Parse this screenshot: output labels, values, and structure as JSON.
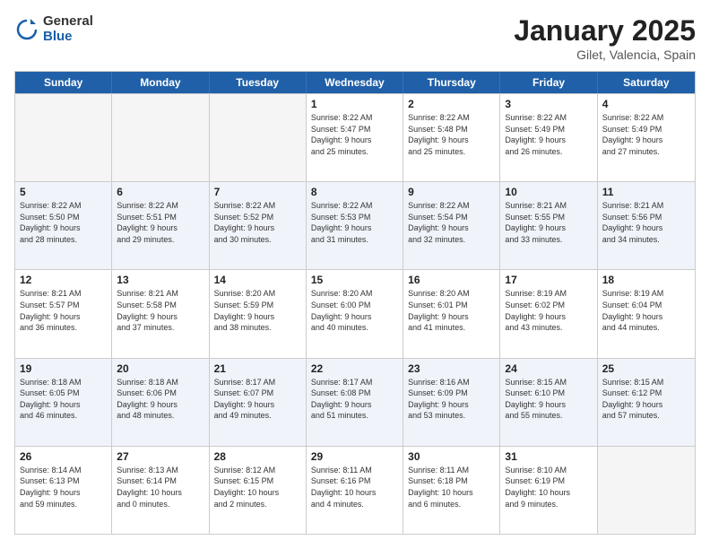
{
  "logo": {
    "general": "General",
    "blue": "Blue"
  },
  "title": "January 2025",
  "subtitle": "Gilet, Valencia, Spain",
  "days": [
    "Sunday",
    "Monday",
    "Tuesday",
    "Wednesday",
    "Thursday",
    "Friday",
    "Saturday"
  ],
  "weeks": [
    [
      {
        "day": "",
        "empty": true
      },
      {
        "day": "",
        "empty": true
      },
      {
        "day": "",
        "empty": true
      },
      {
        "day": "1",
        "line1": "Sunrise: 8:22 AM",
        "line2": "Sunset: 5:47 PM",
        "line3": "Daylight: 9 hours",
        "line4": "and 25 minutes."
      },
      {
        "day": "2",
        "line1": "Sunrise: 8:22 AM",
        "line2": "Sunset: 5:48 PM",
        "line3": "Daylight: 9 hours",
        "line4": "and 25 minutes."
      },
      {
        "day": "3",
        "line1": "Sunrise: 8:22 AM",
        "line2": "Sunset: 5:49 PM",
        "line3": "Daylight: 9 hours",
        "line4": "and 26 minutes."
      },
      {
        "day": "4",
        "line1": "Sunrise: 8:22 AM",
        "line2": "Sunset: 5:49 PM",
        "line3": "Daylight: 9 hours",
        "line4": "and 27 minutes."
      }
    ],
    [
      {
        "day": "5",
        "line1": "Sunrise: 8:22 AM",
        "line2": "Sunset: 5:50 PM",
        "line3": "Daylight: 9 hours",
        "line4": "and 28 minutes."
      },
      {
        "day": "6",
        "line1": "Sunrise: 8:22 AM",
        "line2": "Sunset: 5:51 PM",
        "line3": "Daylight: 9 hours",
        "line4": "and 29 minutes."
      },
      {
        "day": "7",
        "line1": "Sunrise: 8:22 AM",
        "line2": "Sunset: 5:52 PM",
        "line3": "Daylight: 9 hours",
        "line4": "and 30 minutes."
      },
      {
        "day": "8",
        "line1": "Sunrise: 8:22 AM",
        "line2": "Sunset: 5:53 PM",
        "line3": "Daylight: 9 hours",
        "line4": "and 31 minutes."
      },
      {
        "day": "9",
        "line1": "Sunrise: 8:22 AM",
        "line2": "Sunset: 5:54 PM",
        "line3": "Daylight: 9 hours",
        "line4": "and 32 minutes."
      },
      {
        "day": "10",
        "line1": "Sunrise: 8:21 AM",
        "line2": "Sunset: 5:55 PM",
        "line3": "Daylight: 9 hours",
        "line4": "and 33 minutes."
      },
      {
        "day": "11",
        "line1": "Sunrise: 8:21 AM",
        "line2": "Sunset: 5:56 PM",
        "line3": "Daylight: 9 hours",
        "line4": "and 34 minutes."
      }
    ],
    [
      {
        "day": "12",
        "line1": "Sunrise: 8:21 AM",
        "line2": "Sunset: 5:57 PM",
        "line3": "Daylight: 9 hours",
        "line4": "and 36 minutes."
      },
      {
        "day": "13",
        "line1": "Sunrise: 8:21 AM",
        "line2": "Sunset: 5:58 PM",
        "line3": "Daylight: 9 hours",
        "line4": "and 37 minutes."
      },
      {
        "day": "14",
        "line1": "Sunrise: 8:20 AM",
        "line2": "Sunset: 5:59 PM",
        "line3": "Daylight: 9 hours",
        "line4": "and 38 minutes."
      },
      {
        "day": "15",
        "line1": "Sunrise: 8:20 AM",
        "line2": "Sunset: 6:00 PM",
        "line3": "Daylight: 9 hours",
        "line4": "and 40 minutes."
      },
      {
        "day": "16",
        "line1": "Sunrise: 8:20 AM",
        "line2": "Sunset: 6:01 PM",
        "line3": "Daylight: 9 hours",
        "line4": "and 41 minutes."
      },
      {
        "day": "17",
        "line1": "Sunrise: 8:19 AM",
        "line2": "Sunset: 6:02 PM",
        "line3": "Daylight: 9 hours",
        "line4": "and 43 minutes."
      },
      {
        "day": "18",
        "line1": "Sunrise: 8:19 AM",
        "line2": "Sunset: 6:04 PM",
        "line3": "Daylight: 9 hours",
        "line4": "and 44 minutes."
      }
    ],
    [
      {
        "day": "19",
        "line1": "Sunrise: 8:18 AM",
        "line2": "Sunset: 6:05 PM",
        "line3": "Daylight: 9 hours",
        "line4": "and 46 minutes."
      },
      {
        "day": "20",
        "line1": "Sunrise: 8:18 AM",
        "line2": "Sunset: 6:06 PM",
        "line3": "Daylight: 9 hours",
        "line4": "and 48 minutes."
      },
      {
        "day": "21",
        "line1": "Sunrise: 8:17 AM",
        "line2": "Sunset: 6:07 PM",
        "line3": "Daylight: 9 hours",
        "line4": "and 49 minutes."
      },
      {
        "day": "22",
        "line1": "Sunrise: 8:17 AM",
        "line2": "Sunset: 6:08 PM",
        "line3": "Daylight: 9 hours",
        "line4": "and 51 minutes."
      },
      {
        "day": "23",
        "line1": "Sunrise: 8:16 AM",
        "line2": "Sunset: 6:09 PM",
        "line3": "Daylight: 9 hours",
        "line4": "and 53 minutes."
      },
      {
        "day": "24",
        "line1": "Sunrise: 8:15 AM",
        "line2": "Sunset: 6:10 PM",
        "line3": "Daylight: 9 hours",
        "line4": "and 55 minutes."
      },
      {
        "day": "25",
        "line1": "Sunrise: 8:15 AM",
        "line2": "Sunset: 6:12 PM",
        "line3": "Daylight: 9 hours",
        "line4": "and 57 minutes."
      }
    ],
    [
      {
        "day": "26",
        "line1": "Sunrise: 8:14 AM",
        "line2": "Sunset: 6:13 PM",
        "line3": "Daylight: 9 hours",
        "line4": "and 59 minutes."
      },
      {
        "day": "27",
        "line1": "Sunrise: 8:13 AM",
        "line2": "Sunset: 6:14 PM",
        "line3": "Daylight: 10 hours",
        "line4": "and 0 minutes."
      },
      {
        "day": "28",
        "line1": "Sunrise: 8:12 AM",
        "line2": "Sunset: 6:15 PM",
        "line3": "Daylight: 10 hours",
        "line4": "and 2 minutes."
      },
      {
        "day": "29",
        "line1": "Sunrise: 8:11 AM",
        "line2": "Sunset: 6:16 PM",
        "line3": "Daylight: 10 hours",
        "line4": "and 4 minutes."
      },
      {
        "day": "30",
        "line1": "Sunrise: 8:11 AM",
        "line2": "Sunset: 6:18 PM",
        "line3": "Daylight: 10 hours",
        "line4": "and 6 minutes."
      },
      {
        "day": "31",
        "line1": "Sunrise: 8:10 AM",
        "line2": "Sunset: 6:19 PM",
        "line3": "Daylight: 10 hours",
        "line4": "and 9 minutes."
      },
      {
        "day": "",
        "empty": true
      }
    ]
  ]
}
